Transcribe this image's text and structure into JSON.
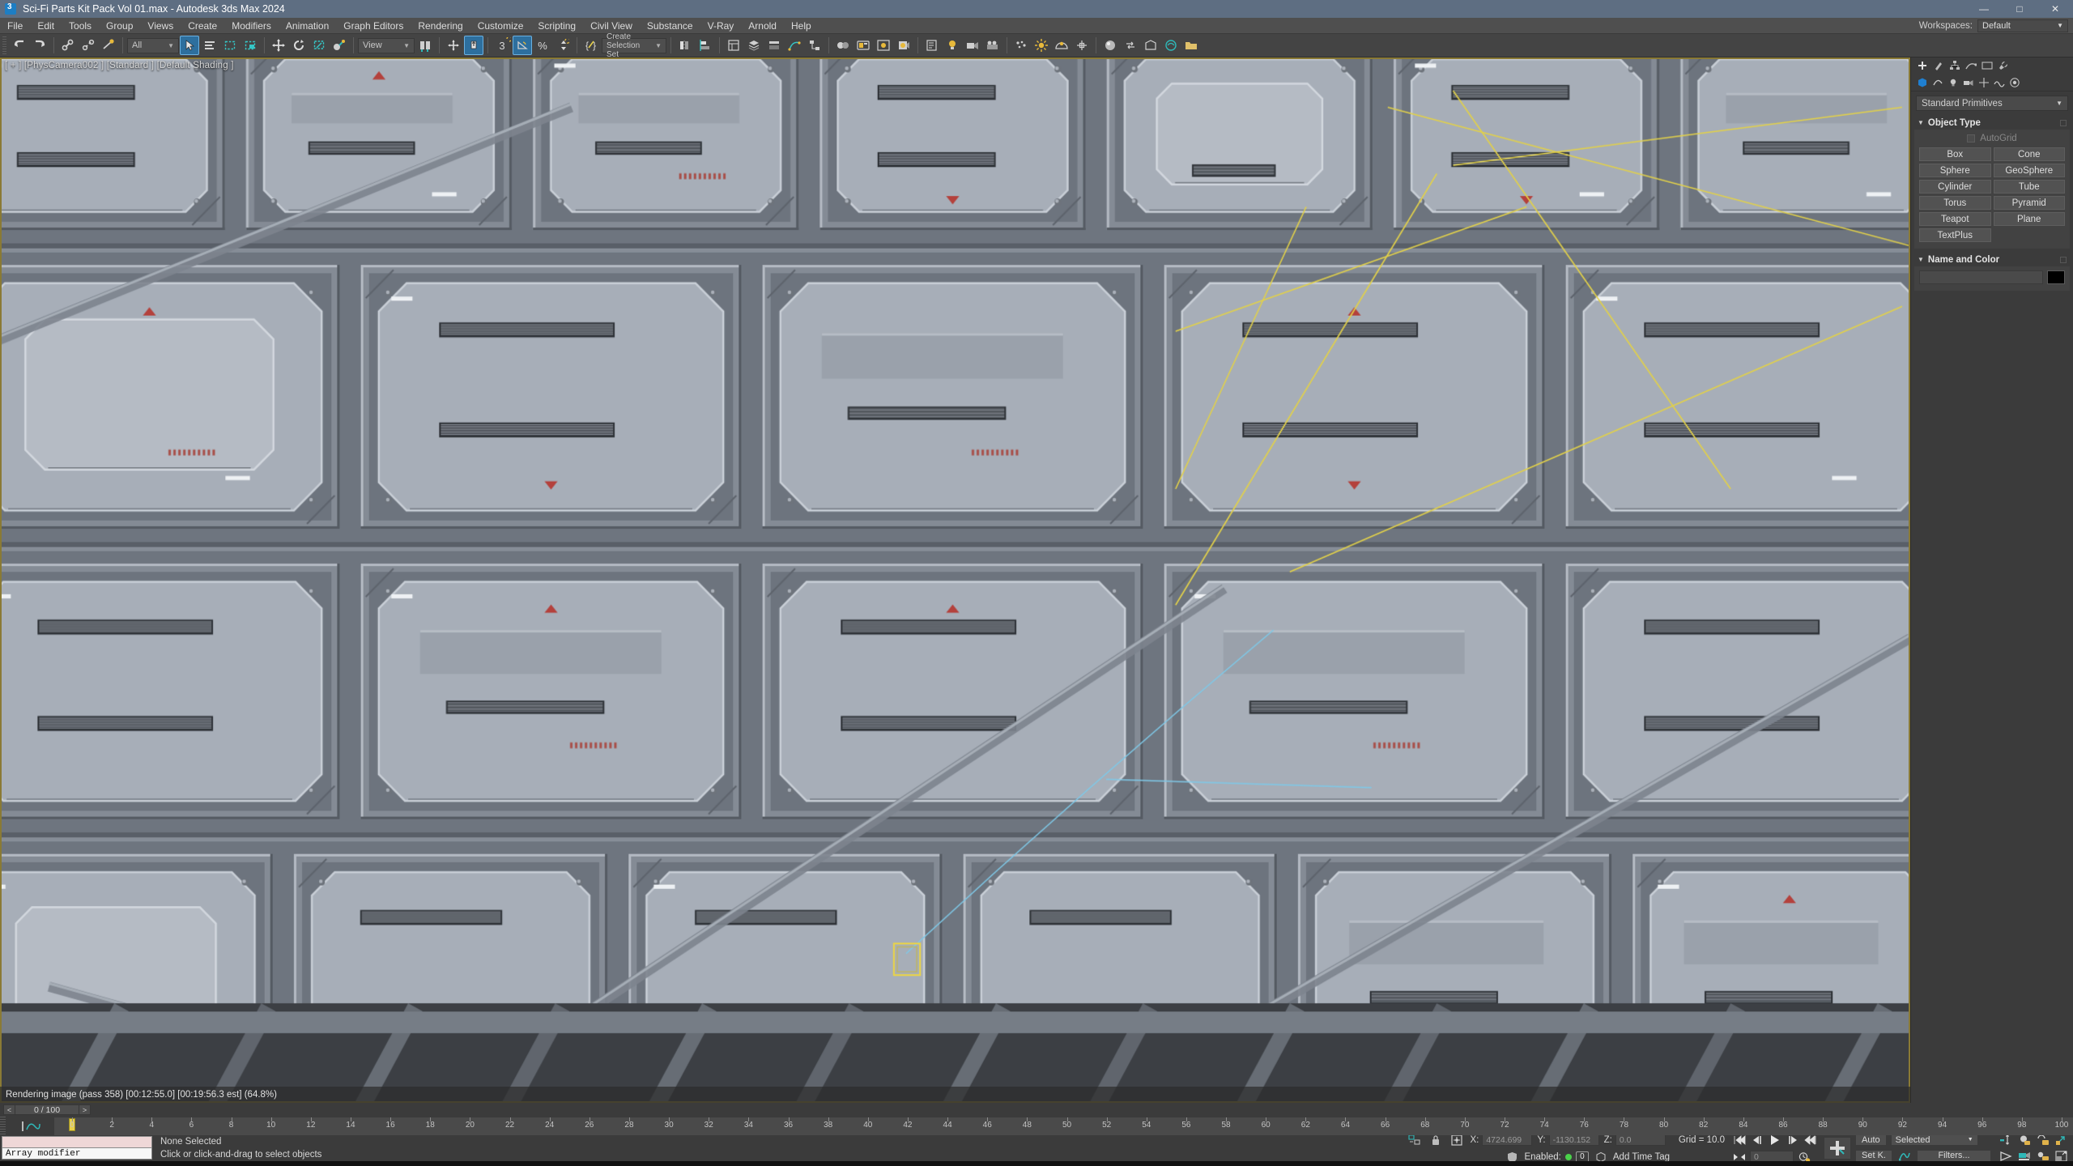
{
  "window": {
    "title": "Sci-Fi Parts Kit Pack Vol 01.max - Autodesk 3ds Max 2024",
    "minimize": "—",
    "maximize": "□",
    "close": "✕"
  },
  "menubar": {
    "items": [
      "File",
      "Edit",
      "Tools",
      "Group",
      "Views",
      "Create",
      "Modifiers",
      "Animation",
      "Graph Editors",
      "Rendering",
      "Customize",
      "Scripting",
      "Civil View",
      "Substance",
      "V-Ray",
      "Arnold",
      "Help"
    ],
    "workspaces_label": "Workspaces:",
    "workspaces_value": "Default",
    "arrow": "▼"
  },
  "toolbar": {
    "selection_filter": "All",
    "ref_coord_system": "View",
    "named_selection_set": "Create Selection Set",
    "arrow": "▼",
    "snap_toggle_label": "3",
    "percent_label": "%"
  },
  "viewport": {
    "label": "[ + ] [PhysCamera002 ] [Standard ] [Default Shading ]",
    "render_status": "Rendering image (pass 358) [00:12:55.0] [00:19:56.3 est]    (64.8%)"
  },
  "command_panel": {
    "category_dropdown": "Standard Primitives",
    "object_type": {
      "title": "Object Type",
      "autogrid": "AutoGrid",
      "buttons": [
        "Box",
        "Cone",
        "Sphere",
        "GeoSphere",
        "Cylinder",
        "Tube",
        "Torus",
        "Pyramid",
        "Teapot",
        "Plane",
        "TextPlus"
      ]
    },
    "name_and_color": {
      "title": "Name and Color",
      "name_value": "",
      "color": "#000000"
    },
    "arrow_down": "▼",
    "triangle": "▼"
  },
  "trackbar": {
    "prev_frame": "<",
    "frame_readout": "0 / 100",
    "next_frame": ">",
    "ticks": [
      "0",
      "2",
      "4",
      "6",
      "8",
      "10",
      "12",
      "14",
      "16",
      "18",
      "20",
      "22",
      "24",
      "26",
      "28",
      "30",
      "32",
      "34",
      "36",
      "38",
      "40",
      "42",
      "44",
      "46",
      "48",
      "50",
      "52",
      "54",
      "56",
      "58",
      "60",
      "62",
      "64",
      "66",
      "68",
      "70",
      "72",
      "74",
      "76",
      "78",
      "80",
      "82",
      "84",
      "86",
      "88",
      "90",
      "92",
      "94",
      "96",
      "98",
      "100"
    ],
    "current_frame": 0,
    "range_start": 0,
    "range_end": 100
  },
  "statusbar": {
    "maxscript_listener_line": "Array modifier",
    "selection_status": "None Selected",
    "prompt": "Click or click-and-drag to select objects",
    "coords": {
      "x_label": "X:",
      "x_value": "4724.699",
      "y_label": "Y:",
      "y_value": "-1130.152",
      "z_label": "Z:",
      "z_value": "0.0"
    },
    "grid_label": "Grid = 10.0",
    "enabled_label": "Enabled:",
    "enabled_count": "0",
    "add_time_tag": "Add Time Tag",
    "auto_key": "Auto",
    "set_key": "Set K.",
    "key_filters": "Filters...",
    "key_mode_selection": "Selected",
    "spinner_value": "0",
    "arrow": "▼"
  },
  "colors": {
    "accent_blue": "#2d6f9e",
    "title_bar": "#5e6e82",
    "panel_bg": "#3b3b3b",
    "viewport_bg": "#3f3f3f",
    "viewport_border": "#8a7a35",
    "highlight_yellow": "#e8d24a",
    "green_status": "#4ad24a"
  }
}
